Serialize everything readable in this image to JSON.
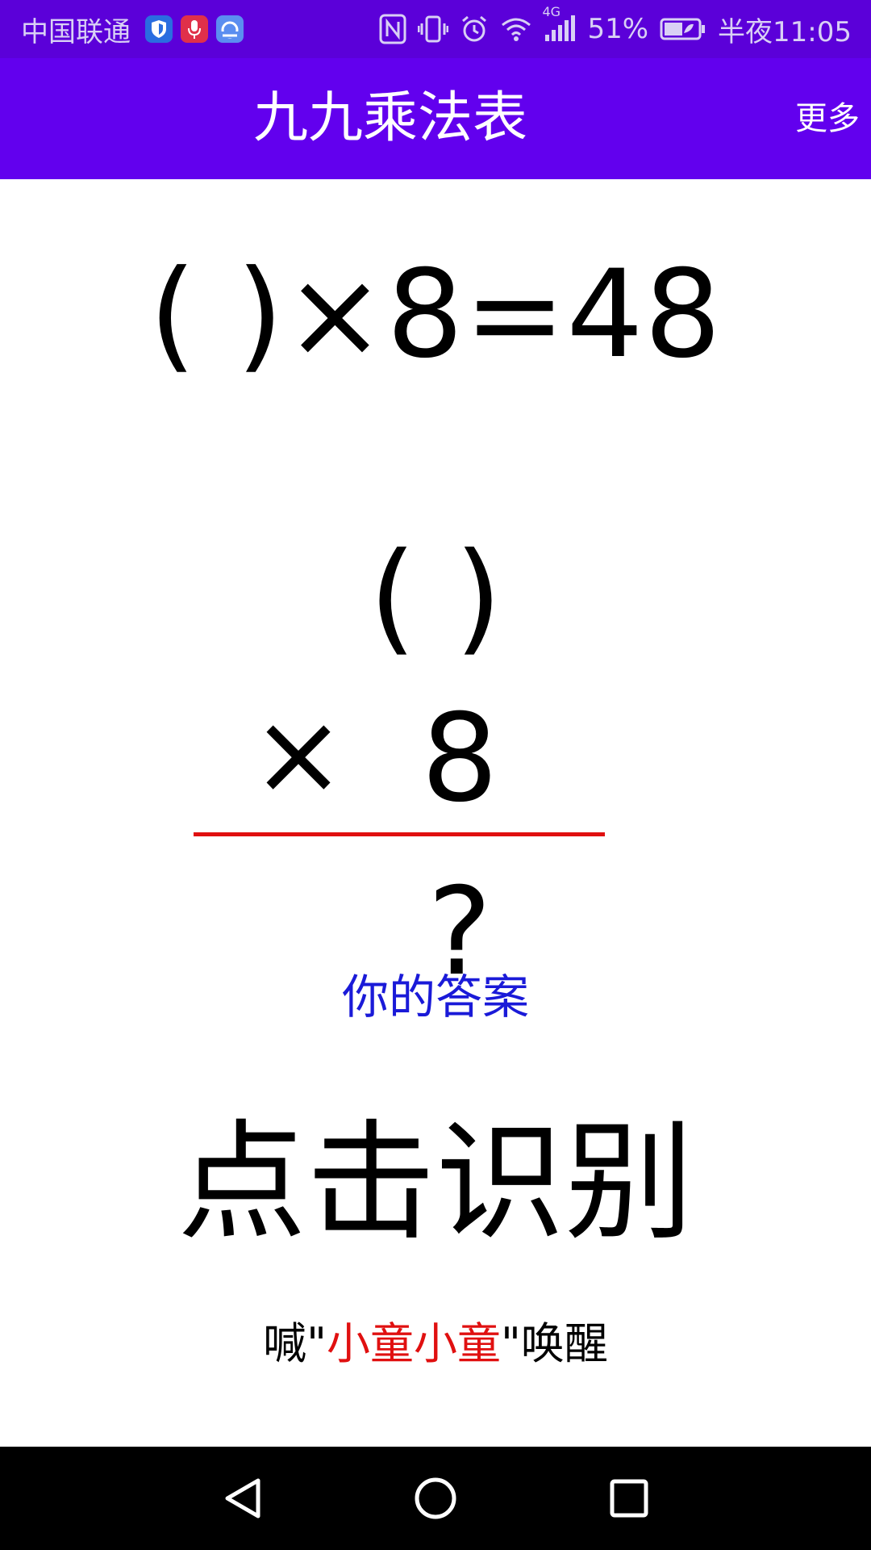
{
  "status_bar": {
    "carrier": "中国联通",
    "battery_percent": "51%",
    "network_type": "4G",
    "time": "半夜11:05",
    "icons": [
      "shield-app-icon",
      "microphone-app-icon",
      "cloud-app-icon",
      "nfc-icon",
      "vibrate-icon",
      "alarm-icon",
      "wifi-icon",
      "signal-icon",
      "battery-icon"
    ],
    "colors": {
      "background": "#5b00d9",
      "foreground": "#d9d0f5"
    }
  },
  "app_bar": {
    "title": "九九乘法表",
    "more_label": "更多",
    "background": "#6200ee"
  },
  "quiz": {
    "equation": "( )×8=48",
    "vertical": {
      "factor": "( )",
      "operator": "×",
      "multiplier": "8",
      "answer": "?"
    },
    "answer_label": "你的答案",
    "answer_label_color": "#1a1ad8",
    "line_color": "#e01010"
  },
  "recognize_button_label": "点击识别",
  "wake_hint": {
    "prefix": "喊\"",
    "wake_word": "小童小童",
    "suffix": "\"唤醒",
    "wake_word_color": "#e01010"
  },
  "nav_bar": {
    "buttons": [
      "back-icon",
      "home-icon",
      "recents-icon"
    ]
  }
}
